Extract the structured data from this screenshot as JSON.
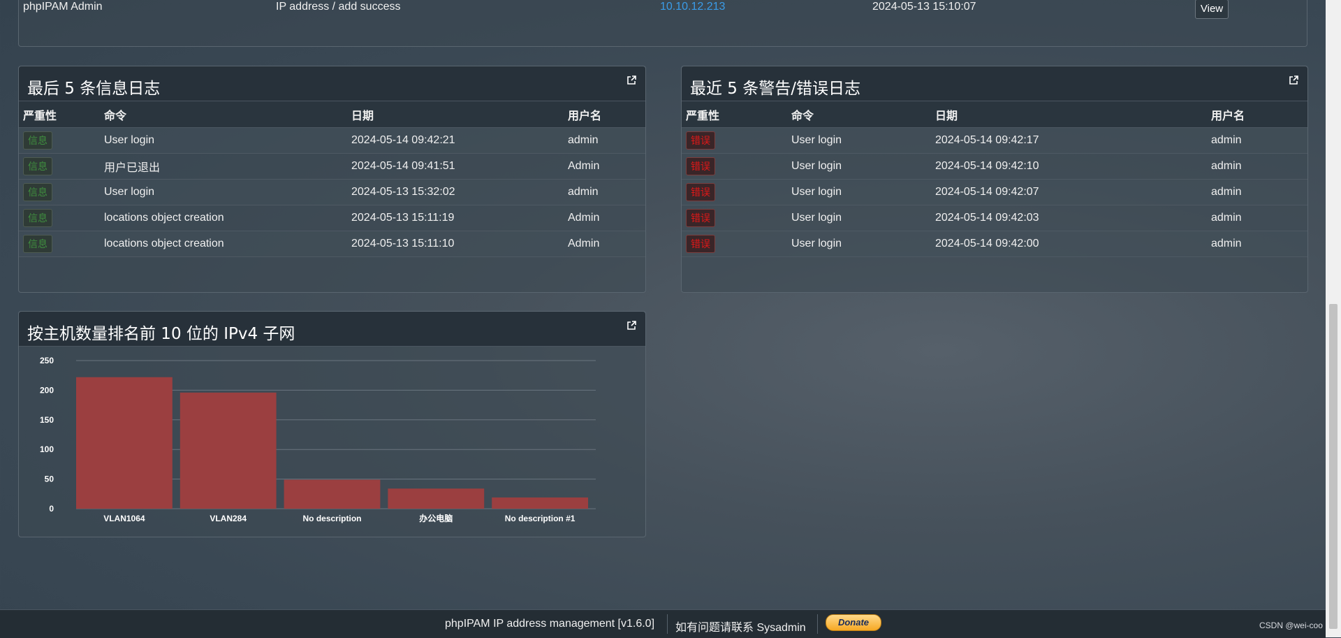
{
  "top_row": {
    "user": "phpIPAM Admin",
    "event": "IP address / add success",
    "ip": "10.10.12.213",
    "date": "2024-05-13 15:10:07",
    "view_label": "View"
  },
  "info_logs": {
    "title": "最后 5 条信息日志",
    "headers": [
      "严重性",
      "命令",
      "日期",
      "用户名"
    ],
    "rows": [
      {
        "severity": "信息",
        "command": "User login",
        "date": "2024-05-14 09:42:21",
        "user": "admin"
      },
      {
        "severity": "信息",
        "command": "用户已退出",
        "date": "2024-05-14 09:41:51",
        "user": "Admin"
      },
      {
        "severity": "信息",
        "command": "User login",
        "date": "2024-05-13 15:32:02",
        "user": "admin"
      },
      {
        "severity": "信息",
        "command": "locations object creation",
        "date": "2024-05-13 15:11:19",
        "user": "Admin"
      },
      {
        "severity": "信息",
        "command": "locations object creation",
        "date": "2024-05-13 15:11:10",
        "user": "Admin"
      }
    ]
  },
  "error_logs": {
    "title": "最近 5 条警告/错误日志",
    "headers": [
      "严重性",
      "命令",
      "日期",
      "用户名"
    ],
    "rows": [
      {
        "severity": "错误",
        "command": "User login",
        "date": "2024-05-14 09:42:17",
        "user": "admin"
      },
      {
        "severity": "错误",
        "command": "User login",
        "date": "2024-05-14 09:42:10",
        "user": "admin"
      },
      {
        "severity": "错误",
        "command": "User login",
        "date": "2024-05-14 09:42:07",
        "user": "admin"
      },
      {
        "severity": "错误",
        "command": "User login",
        "date": "2024-05-14 09:42:03",
        "user": "admin"
      },
      {
        "severity": "错误",
        "command": "User login",
        "date": "2024-05-14 09:42:00",
        "user": "admin"
      }
    ]
  },
  "subnets_panel": {
    "title": "按主机数量排名前 10 位的 IPv4 子网"
  },
  "chart_data": {
    "type": "bar",
    "categories": [
      "VLAN1064",
      "VLAN284",
      "No description",
      "办公电脑",
      "No description #1"
    ],
    "values": [
      222,
      196,
      49,
      34,
      19
    ],
    "yticks": [
      0,
      50,
      100,
      150,
      200,
      250
    ],
    "ylim": [
      0,
      250
    ],
    "grid": true,
    "bar_color": "#9b3f40"
  },
  "footer": {
    "app": "phpIPAM IP address management [v1.6.0]",
    "contact": "如有问题请联系 Sysadmin",
    "donate": "Donate"
  },
  "watermark": "CSDN @wei-coo"
}
